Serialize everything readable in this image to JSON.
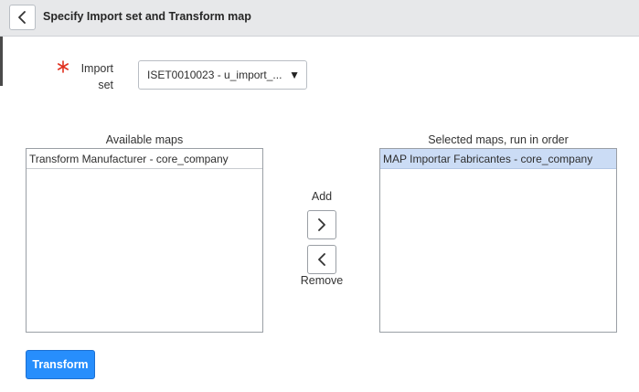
{
  "header": {
    "title": "Specify Import set and Transform map"
  },
  "form": {
    "import_set": {
      "label": "Import set",
      "value": "ISET0010023 - u_import_..."
    }
  },
  "available_maps": {
    "label": "Available maps",
    "items": [
      "Transform Manufacturer - core_company"
    ]
  },
  "selected_maps": {
    "label": "Selected maps, run in order",
    "items": [
      "MAP Importar Fabricantes - core_company"
    ]
  },
  "actions": {
    "add_label": "Add",
    "remove_label": "Remove",
    "transform_label": "Transform"
  },
  "icons": {
    "back": "chevron-left-icon",
    "required": "asterisk-icon",
    "dropdown": "caret-down-icon",
    "add": "chevron-right-icon",
    "remove": "chevron-left-icon"
  },
  "colors": {
    "primary": "#278efc",
    "required": "#e0301e",
    "selected_row": "#cbdcf5",
    "header_bg": "#e7e8ea"
  }
}
